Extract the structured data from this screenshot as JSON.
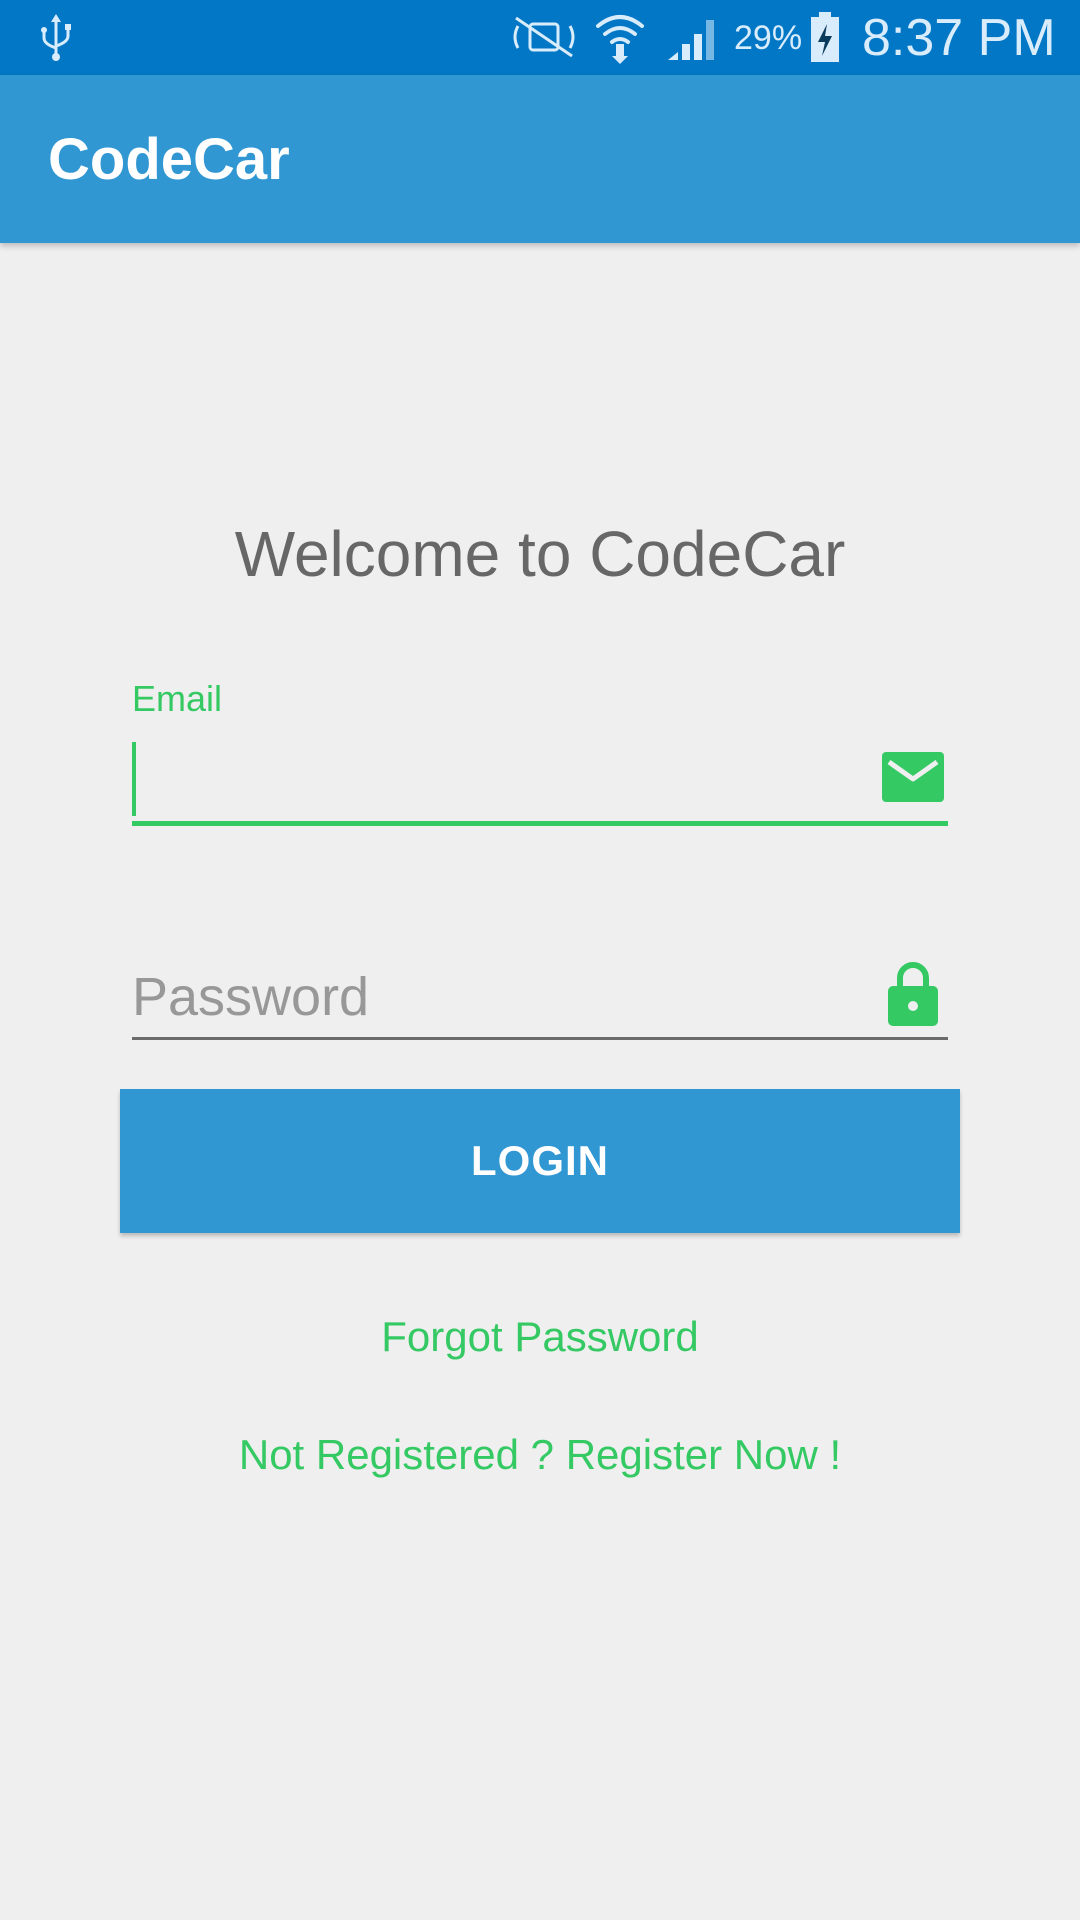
{
  "status_bar": {
    "battery_percent": "29%",
    "time": "8:37 PM",
    "icons": [
      "usb-icon",
      "mute-icon",
      "wifi-icon",
      "signal-icon",
      "battery-charging-icon"
    ]
  },
  "app_bar": {
    "title": "CodeCar"
  },
  "main": {
    "welcome": "Welcome to CodeCar",
    "email": {
      "label": "Email",
      "value": "",
      "icon": "mail-icon"
    },
    "password": {
      "placeholder": "Password",
      "value": "",
      "icon": "lock-icon"
    },
    "login_label": "LOGIN",
    "forgot_password": "Forgot Password",
    "register_link": "Not Registered ? Register Now !"
  },
  "colors": {
    "status_bar": "#0277c5",
    "primary": "#3197d3",
    "accent": "#35c964",
    "background": "#efeff0"
  }
}
